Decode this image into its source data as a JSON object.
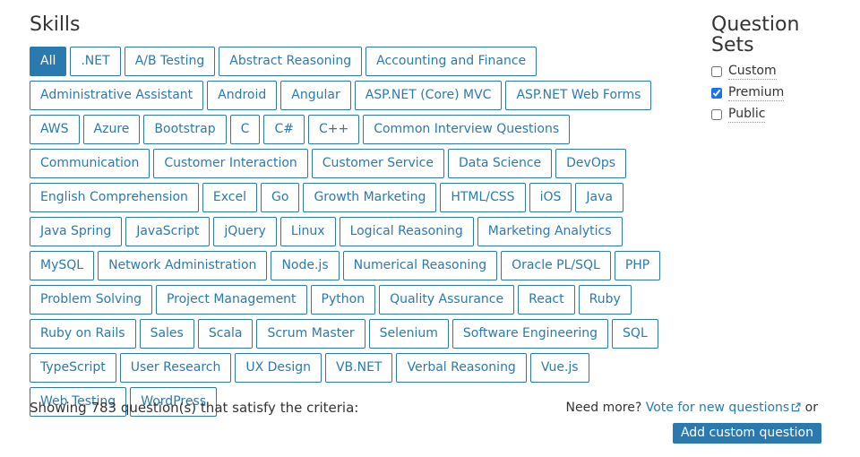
{
  "skills": {
    "heading": "Skills",
    "tags": [
      {
        "label": "All",
        "active": true
      },
      {
        "label": ".NET"
      },
      {
        "label": "A/B Testing"
      },
      {
        "label": "Abstract Reasoning"
      },
      {
        "label": "Accounting and Finance"
      },
      {
        "label": "Administrative Assistant"
      },
      {
        "label": "Android"
      },
      {
        "label": "Angular"
      },
      {
        "label": "ASP.NET (Core) MVC"
      },
      {
        "label": "ASP.NET Web Forms"
      },
      {
        "label": "AWS"
      },
      {
        "label": "Azure"
      },
      {
        "label": "Bootstrap"
      },
      {
        "label": "C"
      },
      {
        "label": "C#"
      },
      {
        "label": "C++"
      },
      {
        "label": "Common Interview Questions"
      },
      {
        "label": "Communication"
      },
      {
        "label": "Customer Interaction"
      },
      {
        "label": "Customer Service"
      },
      {
        "label": "Data Science"
      },
      {
        "label": "DevOps"
      },
      {
        "label": "English Comprehension"
      },
      {
        "label": "Excel"
      },
      {
        "label": "Go"
      },
      {
        "label": "Growth Marketing"
      },
      {
        "label": "HTML/CSS"
      },
      {
        "label": "iOS"
      },
      {
        "label": "Java"
      },
      {
        "label": "Java Spring"
      },
      {
        "label": "JavaScript"
      },
      {
        "label": "jQuery"
      },
      {
        "label": "Linux"
      },
      {
        "label": "Logical Reasoning"
      },
      {
        "label": "Marketing Analytics"
      },
      {
        "label": "MySQL"
      },
      {
        "label": "Network Administration"
      },
      {
        "label": "Node.js"
      },
      {
        "label": "Numerical Reasoning"
      },
      {
        "label": "Oracle PL/SQL"
      },
      {
        "label": "PHP"
      },
      {
        "label": "Problem Solving"
      },
      {
        "label": "Project Management"
      },
      {
        "label": "Python"
      },
      {
        "label": "Quality Assurance"
      },
      {
        "label": "React"
      },
      {
        "label": "Ruby"
      },
      {
        "label": "Ruby on Rails"
      },
      {
        "label": "Sales"
      },
      {
        "label": "Scala"
      },
      {
        "label": "Scrum Master"
      },
      {
        "label": "Selenium"
      },
      {
        "label": "Software Engineering"
      },
      {
        "label": "SQL"
      },
      {
        "label": "TypeScript"
      },
      {
        "label": "User Research"
      },
      {
        "label": "UX Design"
      },
      {
        "label": "VB.NET"
      },
      {
        "label": "Verbal Reasoning"
      },
      {
        "label": "Vue.js"
      },
      {
        "label": "Web Testing"
      },
      {
        "label": "WordPress"
      }
    ]
  },
  "question_sets": {
    "heading": "Question Sets",
    "items": [
      {
        "label": "Custom",
        "checked": false
      },
      {
        "label": "Premium",
        "checked": true
      },
      {
        "label": "Public",
        "checked": false
      }
    ]
  },
  "footer": {
    "showing_text": "Showing 783 question(s) that satisfy the criteria:",
    "need_more_prefix": "Need more?",
    "vote_link": "Vote for new questions",
    "or_text": "or",
    "add_button": "Add custom question"
  },
  "colors": {
    "accent": "#2a7ab0",
    "text": "#333333"
  },
  "icons": {
    "external": "external-link-icon"
  }
}
